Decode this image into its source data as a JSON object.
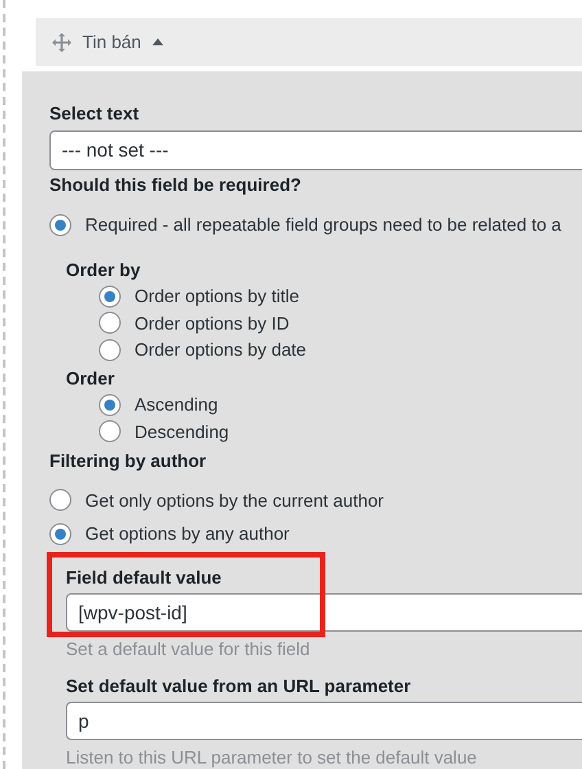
{
  "header": {
    "title": "Tin bán",
    "expanded": true
  },
  "select_text": {
    "label": "Select text",
    "value": "--- not set ---"
  },
  "required": {
    "label": "Should this field be required?",
    "options": [
      {
        "label": "Required - all repeatable field groups need to be related to a",
        "selected": true
      }
    ]
  },
  "order_by": {
    "label": "Order by",
    "options": [
      {
        "label": "Order options by title",
        "selected": true
      },
      {
        "label": "Order options by ID",
        "selected": false
      },
      {
        "label": "Order options by date",
        "selected": false
      }
    ]
  },
  "order": {
    "label": "Order",
    "options": [
      {
        "label": "Ascending",
        "selected": true
      },
      {
        "label": "Descending",
        "selected": false
      }
    ]
  },
  "author_filter": {
    "label": "Filtering by author",
    "options": [
      {
        "label": "Get only options by the current author",
        "selected": false
      },
      {
        "label": "Get options by any author",
        "selected": true
      }
    ]
  },
  "default_value": {
    "label": "Field default value",
    "value": "[wpv-post-id]",
    "hint": "Set a default value for this field",
    "highlighted": true
  },
  "url_parameter": {
    "label": "Set default value from an URL parameter",
    "value": "p",
    "hint": "Listen to this URL parameter to set the default value"
  }
}
